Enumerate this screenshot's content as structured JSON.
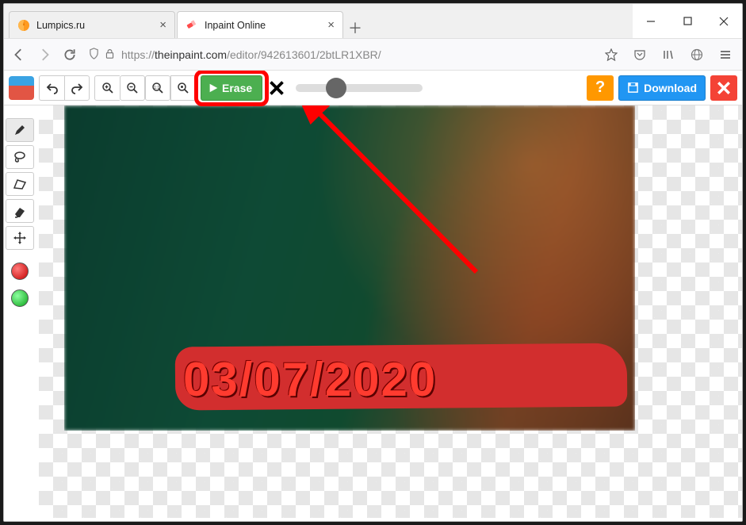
{
  "tabs": [
    {
      "title": "Lumpics.ru",
      "active": false
    },
    {
      "title": "Inpaint Online",
      "active": true
    }
  ],
  "url": {
    "domain": "theinpaint.com",
    "path": "/editor/942613601/2btLR1XBR/",
    "prefix": "https://"
  },
  "toolbar": {
    "erase_label": "Erase",
    "download_label": "Download"
  },
  "image": {
    "date_text": "03/07/2020"
  }
}
